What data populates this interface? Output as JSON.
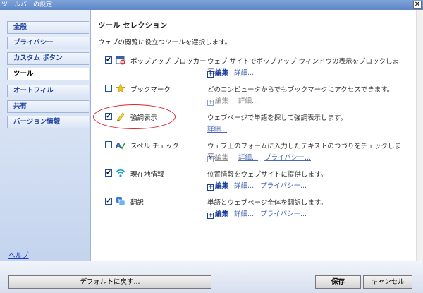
{
  "window": {
    "title": "ツールバーの設定",
    "close_glyph": "✕"
  },
  "sidebar": {
    "items": [
      {
        "label": "全般"
      },
      {
        "label": "プライバシー"
      },
      {
        "label": "カスタム ボタン"
      },
      {
        "label": "ツール"
      },
      {
        "label": "オートフィル"
      },
      {
        "label": "共有"
      },
      {
        "label": "バージョン情報"
      }
    ],
    "active_item": "ツール",
    "help_link": "ヘルプ"
  },
  "main": {
    "heading": "ツール セレクション",
    "subheading": "ウェブの閲覧に役立つツールを選択します。",
    "tools": [
      {
        "name": "ポップアップ ブロッカー",
        "checked": true,
        "icon": "popup-blocker-icon",
        "description": "ウェブ サイトでポップアップ ウィンドウの表示をブロックします。",
        "edit": "編集",
        "details": "詳細...",
        "privacy": ""
      },
      {
        "name": "ブックマーク",
        "checked": false,
        "icon": "star-icon",
        "description": "どのコンピュータからでもブックマークにアクセスできます。",
        "edit": "編集",
        "details": "詳細...",
        "privacy": ""
      },
      {
        "name": "強調表示",
        "checked": true,
        "icon": "highlighter-icon",
        "description": "ウェブページで単語を探して強調表示します。",
        "edit": "",
        "details": "詳細...",
        "privacy": ""
      },
      {
        "name": "スペル チェック",
        "checked": false,
        "icon": "spell-check-icon",
        "description": "ウェブ上のフォームに入力したテキストのつづりをチェックします。",
        "edit": "編集",
        "details": "詳細...",
        "privacy": "プライバシー..."
      },
      {
        "name": "現在地情報",
        "checked": true,
        "icon": "wireless-signal-icon",
        "description": "位置情報をウェブサイトに提供します。",
        "edit": "編集",
        "details": "詳細...",
        "privacy": "プライバシー..."
      },
      {
        "name": "翻訳",
        "checked": true,
        "icon": "translate-icon",
        "description": "単語とウェブページ全体を翻訳します。",
        "edit": "編集",
        "details": "詳細...",
        "privacy": "プライバシー..."
      }
    ]
  },
  "footer": {
    "reset_button": "デフォルトに戻す...",
    "save_button": "保存",
    "cancel_button": "キャンセル"
  },
  "colors": {
    "link": "#4a68b7",
    "annotation": "#d9262e",
    "sidebar_text": "#2346a1"
  }
}
